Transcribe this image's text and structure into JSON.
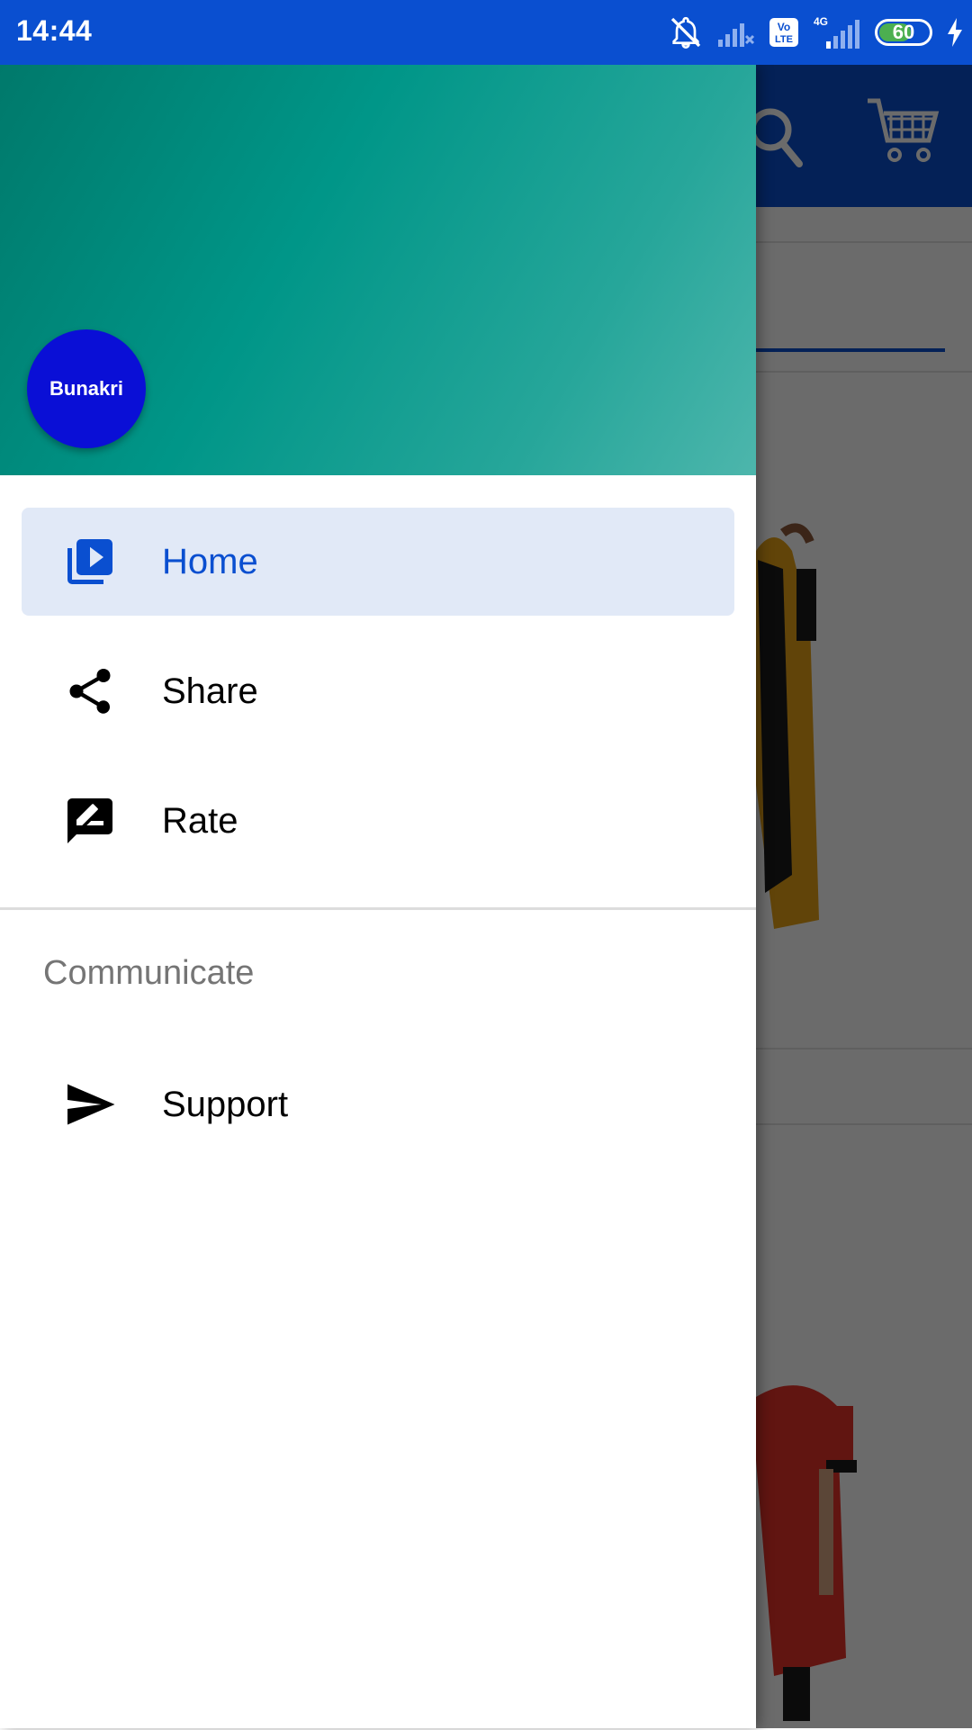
{
  "status_bar": {
    "time": "14:44",
    "icons": [
      "mute-icon",
      "no-signal-icon",
      "volte-icon",
      "4g-signal-icon",
      "battery-icon",
      "charging-icon"
    ],
    "volte_label": "Vo\nLTE",
    "network_label": "4G",
    "battery_level": "60"
  },
  "background_app": {
    "toolbar_color": "#0a4fd0",
    "icons": [
      "search-icon",
      "cart-icon"
    ]
  },
  "drawer": {
    "header": {
      "avatar_text": "Bunakri"
    },
    "items": [
      {
        "label": "Home",
        "icon": "video-library-icon",
        "active": true
      },
      {
        "label": "Share",
        "icon": "share-icon",
        "active": false
      },
      {
        "label": "Rate",
        "icon": "rate-review-icon",
        "active": false
      }
    ],
    "section": {
      "title": "Communicate",
      "items": [
        {
          "label": "Support",
          "icon": "send-icon",
          "active": false
        }
      ]
    }
  },
  "colors": {
    "primary": "#0a4fd0",
    "header_gradient_start": "#00796b",
    "header_gradient_end": "#4db6ac",
    "active_item_bg": "#e1e9f7",
    "avatar": "#0a0fd6"
  }
}
